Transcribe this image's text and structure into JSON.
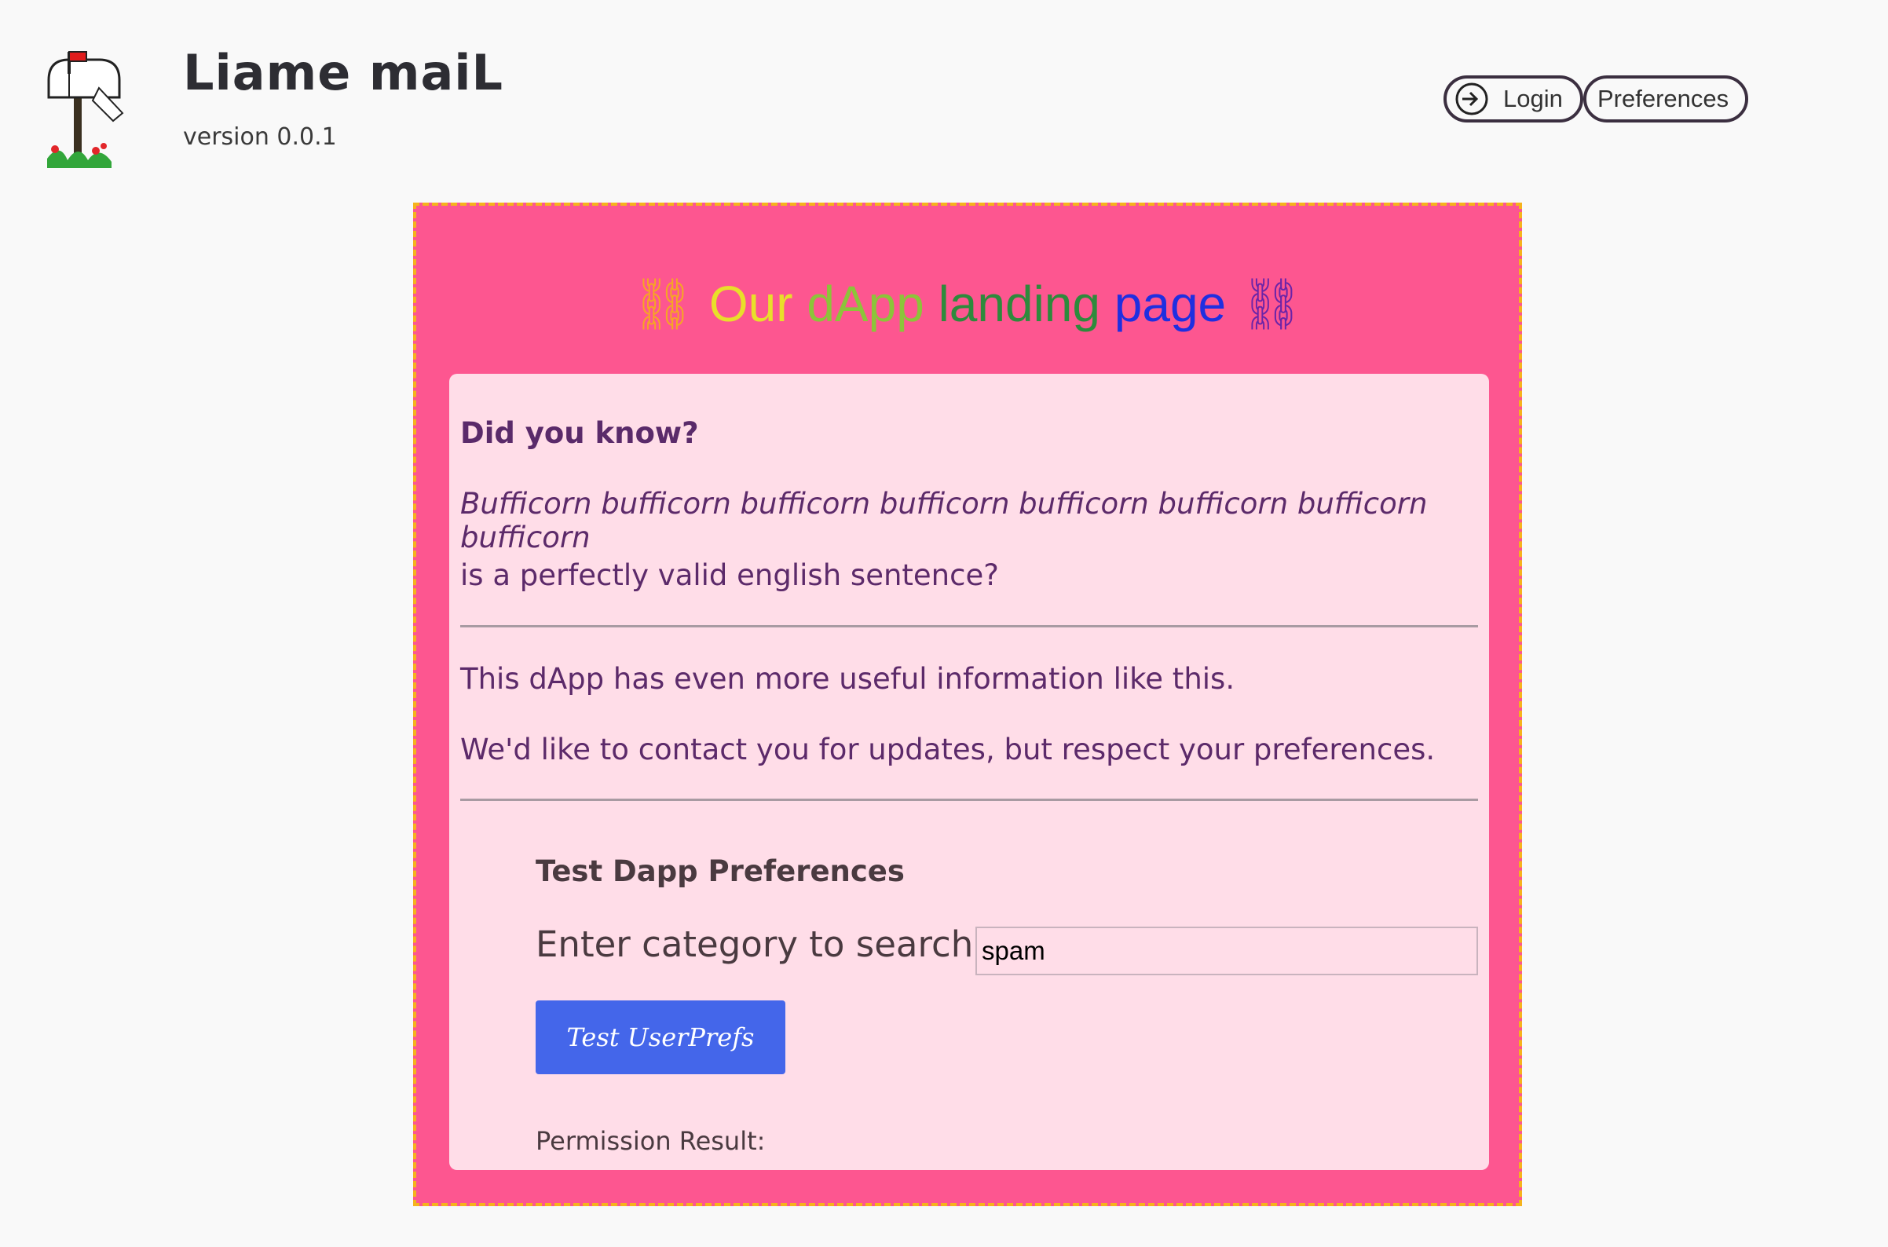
{
  "header": {
    "logo_icon": "mailbox-icon",
    "title": "Liame maiL",
    "version": "version 0.0.1"
  },
  "nav": {
    "login_icon": "login-arrow-icon",
    "login_label": "Login",
    "preferences_label": "Preferences"
  },
  "landing": {
    "title_icon": "chain-link-icon",
    "title_icon_glyph": "⛓",
    "title_words": [
      "Our",
      "dApp",
      "landing",
      "page"
    ],
    "frame_color": "#fd5690",
    "frame_border_color": "#f5b31d"
  },
  "card": {
    "did_you_know": "Did you know?",
    "bufficorn": "Bufficorn bufficorn bufficorn bufficorn bufficorn bufficorn bufficorn bufficorn",
    "valid_sentence": "is a perfectly valid english sentence?",
    "more_info": "This dApp has even more useful information like this.",
    "contact": "We'd like to contact you for updates, but respect your preferences."
  },
  "preferences": {
    "title": "Test Dapp Preferences",
    "category_label": "Enter category to search",
    "category_value": "spam",
    "button_label": "Test UserPrefs",
    "button_color": "#4466ea",
    "permission_result_label": "Permission Result:"
  }
}
